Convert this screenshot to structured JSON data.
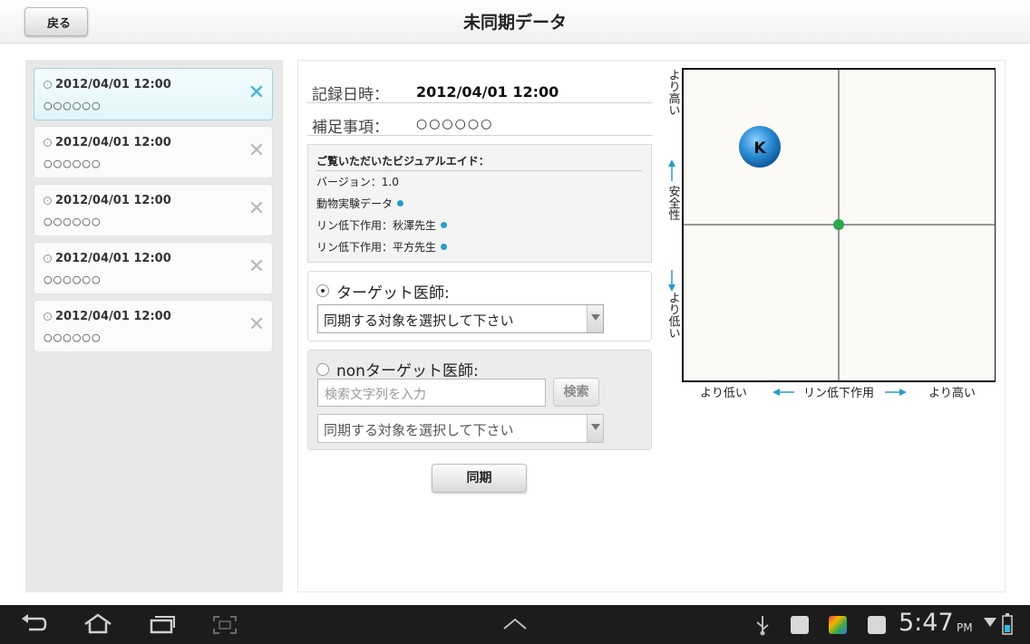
{
  "header": {
    "back_label": "戻る",
    "title": "未同期データ"
  },
  "list": {
    "items": [
      {
        "date": "2012/04/01 12:00",
        "sub": "○○○○○○",
        "selected": true
      },
      {
        "date": "2012/04/01 12:00",
        "sub": "○○○○○○",
        "selected": false
      },
      {
        "date": "2012/04/01 12:00",
        "sub": "○○○○○○",
        "selected": false
      },
      {
        "date": "2012/04/01 12:00",
        "sub": "○○○○○○",
        "selected": false
      },
      {
        "date": "2012/04/01 12:00",
        "sub": "○○○○○○",
        "selected": false
      }
    ],
    "close_glyph": "✕"
  },
  "detail": {
    "record_label": "記録日時：",
    "record_value": "2012/04/01 12:00",
    "note_label": "補足事項：",
    "note_value": "○○○○○○",
    "aid_title": "ご覧いただいたビジュアルエイド：",
    "aid_version": "バージョン：1.0",
    "aid_items": [
      "動物実験データ",
      "リン低下作用：秋澤先生",
      "リン低下作用：平方先生"
    ]
  },
  "target": {
    "label": "ターゲット医師:",
    "select_value": "同期する対象を選択して下さい",
    "checked": true
  },
  "nontarget": {
    "label": "nonターゲット医師:",
    "search_placeholder": "検索文字列を入力",
    "search_button": "検索",
    "select_value": "同期する対象を選択して下さい",
    "checked": false
  },
  "sync_button": "同期",
  "chart": {
    "y_top": "より高い",
    "y_mid": "安全性",
    "y_bottom": "より低い",
    "x_left": "より低い",
    "x_mid": "リン低下作用",
    "x_right": "より高い",
    "marker_label": "K",
    "marker_color": "#2d8fd6",
    "center_dot_color": "#2aa84a"
  },
  "navbar": {
    "time": "5:47",
    "ampm": "PM"
  }
}
